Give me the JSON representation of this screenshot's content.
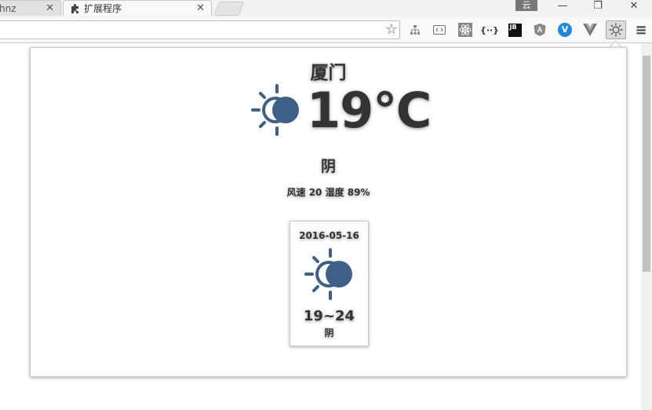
{
  "tabs": [
    {
      "label": "hnz",
      "close": "✕"
    },
    {
      "label": "扩展程序",
      "close": "✕"
    }
  ],
  "window": {
    "badge": "云",
    "minimize": "—",
    "restore": "❐",
    "close": "✕"
  },
  "toolbar": {
    "bookmark_glyph": "☆",
    "extensions": [
      {
        "name": "sitemap-icon",
        "glyph": "⊥"
      },
      {
        "name": "view-source-icon",
        "glyph": "‹›"
      },
      {
        "name": "react-icon",
        "glyph": "⚛"
      },
      {
        "name": "json-icon",
        "glyph": "{··}"
      },
      {
        "name": "jetbrains-icon",
        "glyph": "JB"
      },
      {
        "name": "angular-icon",
        "glyph": "A"
      },
      {
        "name": "v-blue-icon",
        "glyph": "V"
      },
      {
        "name": "vue-icon",
        "glyph": "▼"
      },
      {
        "name": "weather-extension-icon",
        "glyph": "☼"
      }
    ],
    "menu_glyph": "≡"
  },
  "weather": {
    "city": "厦门",
    "temperature": "19℃",
    "condition": "阴",
    "details": "风速 20 湿度 89%",
    "icon": "partly-cloudy-sun-icon",
    "icon_color": "#3d5f88"
  },
  "forecast": [
    {
      "date": "2016-05-16",
      "range": "19~24",
      "condition": "阴",
      "icon": "partly-cloudy-sun-icon"
    }
  ]
}
